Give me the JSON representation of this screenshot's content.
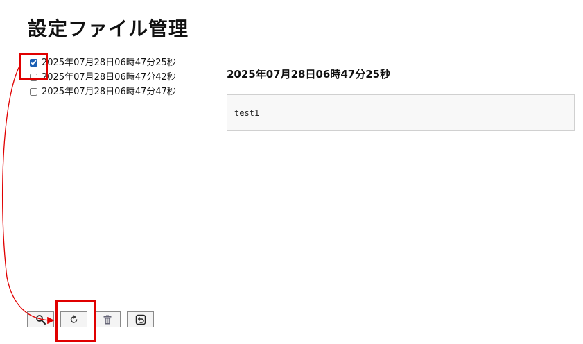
{
  "page": {
    "title": "設定ファイル管理"
  },
  "files": [
    {
      "label": "2025年07月28日06時47分25秒",
      "checked": true
    },
    {
      "label": "2025年07月28日06時47分42秒",
      "checked": false
    },
    {
      "label": "2025年07月28日06時47分47秒",
      "checked": false
    }
  ],
  "preview": {
    "title": "2025年07月28日06時47分25秒",
    "content": "test1"
  },
  "toolbar": {
    "buttons": [
      {
        "name": "search-button",
        "icon": "magnifier-icon"
      },
      {
        "name": "restore-button",
        "icon": "restore-icon"
      },
      {
        "name": "delete-button",
        "icon": "trash-icon"
      },
      {
        "name": "back-button",
        "icon": "return-icon"
      }
    ]
  },
  "annotation": {
    "color": "#e00000"
  }
}
